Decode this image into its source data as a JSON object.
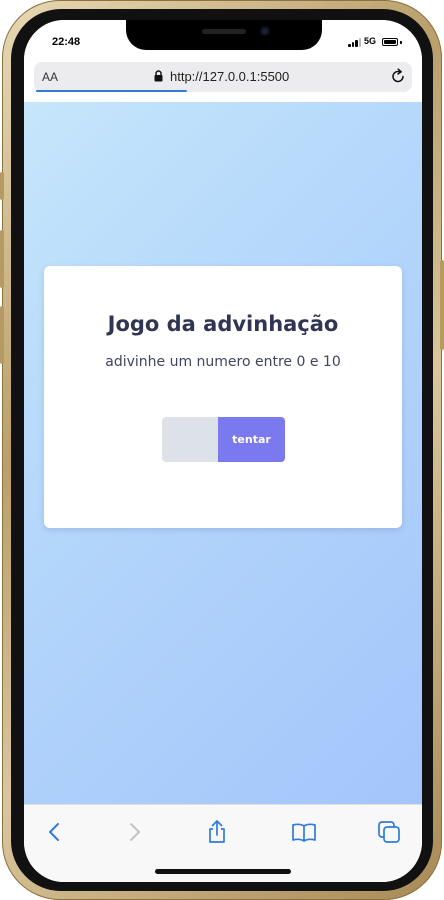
{
  "status": {
    "time": "22:48",
    "network": "5G"
  },
  "browser": {
    "text_size_label": "AA",
    "url": "http://127.0.0.1:5500",
    "load_progress": 0.43
  },
  "game": {
    "title": "Jogo da advinhação",
    "subtitle": "adivinhe um numero entre 0 e 10",
    "input_value": "",
    "button_label": "tentar"
  },
  "toolbar": {
    "icons": [
      "back-icon",
      "forward-icon",
      "share-icon",
      "bookmarks-icon",
      "tabs-icon"
    ]
  },
  "colors": {
    "accent": "#7b79ee",
    "background_start": "#c6e6fb",
    "background_end": "#a3c5fb",
    "title": "#2f3553",
    "browser_blue": "#2f7bdc"
  }
}
